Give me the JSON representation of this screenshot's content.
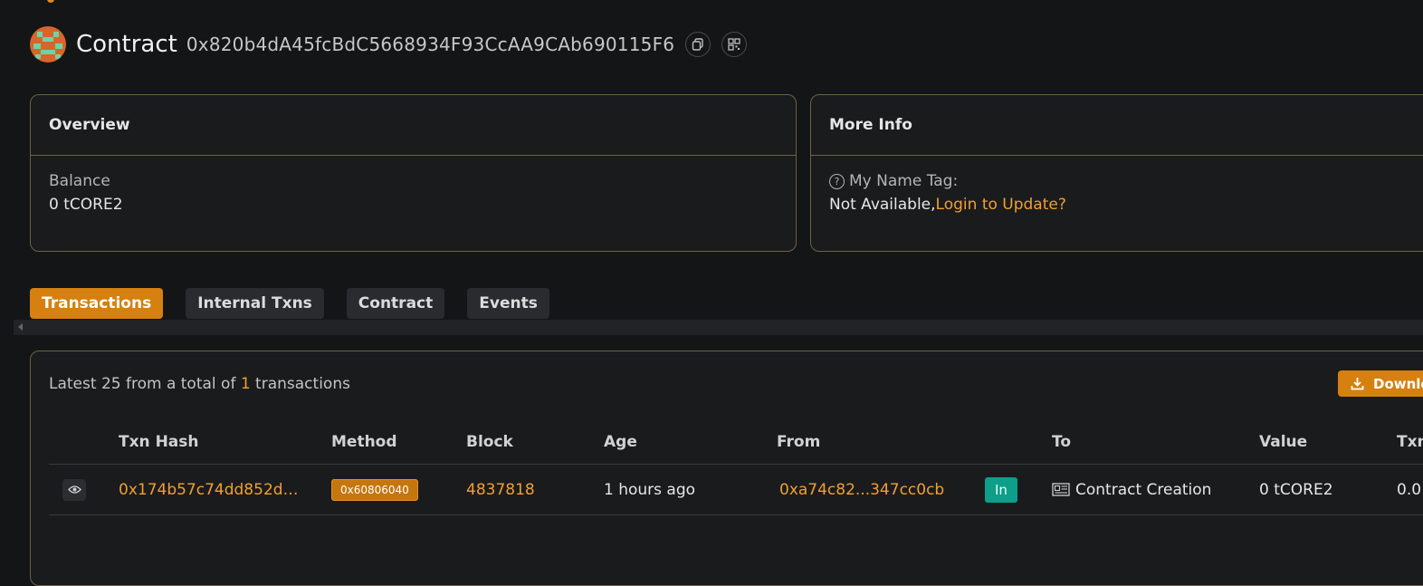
{
  "header": {
    "title": "Contract",
    "address": "0x820b4dA45fcBdC5668934F93CcAA9CAb690115F6",
    "copy_icon": "copy-icon",
    "qr_icon": "qr-code-icon"
  },
  "overview": {
    "title": "Overview",
    "balance_label": "Balance",
    "balance_value": "0 tCORE2"
  },
  "more_info": {
    "title": "More Info",
    "name_tag_label": "My Name Tag:",
    "name_tag_value": "Not Available,",
    "login_link": "Login to Update?"
  },
  "tabs": [
    {
      "label": "Transactions",
      "active": true
    },
    {
      "label": "Internal Txns",
      "active": false
    },
    {
      "label": "Contract",
      "active": false
    },
    {
      "label": "Events",
      "active": false
    }
  ],
  "transactions": {
    "summary_prefix": "Latest 25 from a total of ",
    "summary_count": "1",
    "summary_suffix": " transactions",
    "download_label": "Downlo",
    "columns": [
      "Txn Hash",
      "Method",
      "Block",
      "Age",
      "From",
      "To",
      "Value",
      "Txn"
    ],
    "rows": [
      {
        "txn_hash": "0x174b57c74dd852d…",
        "method": "0x60806040",
        "block": "4837818",
        "age": "1 hours ago",
        "from": "0xa74c82...347cc0cb",
        "direction": "In",
        "to": "Contract Creation",
        "value": "0 tCORE2",
        "fee": "0.0"
      }
    ]
  },
  "colors": {
    "accent": "#d5800f",
    "link": "#f0a030",
    "in_badge": "#0d9f8a",
    "background": "#141517"
  }
}
